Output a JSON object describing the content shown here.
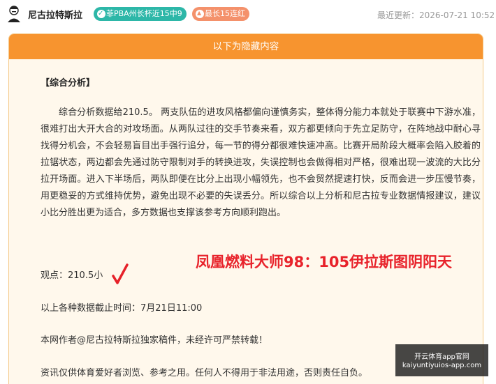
{
  "header": {
    "author": "尼古拉特斯拉",
    "badges": [
      {
        "label": "菲PBA州长杯近15中9",
        "color": "#2db7a8"
      },
      {
        "label": "最长15连红",
        "color": "#f4916b"
      }
    ],
    "updated": "最近更新：2026-07-21 10:52"
  },
  "card": {
    "header": "以下为隐藏内容",
    "section_title": "【综合分析】",
    "analysis": "综合分析数据给210.5。 两支队伍的进攻风格都偏向谨慎务实，整体得分能力本就处于联赛中下游水准，很难打出大开大合的对攻场面。从两队过往的交手节奏来看，双方都更倾向于先立足防守，在阵地战中耐心寻找得分机会，不会轻易盲目出手强行追分，每一节的得分都很难快速冲高。比赛开局阶段大概率会陷入胶着的拉锯状态，两边都会先通过防守限制对手的转换进攻，失误控制也会做得相对严格，很难出现一波流的大比分拉开场面。进入下半场后，两队即便在比分上出现小幅领先，也不会贸然提速打快，反而会进一步压慢节奏，用更稳妥的方式维持优势，避免出现不必要的失误丢分。所以综合以上分析和尼古拉专业数据情报建议，建议小比分胜出更为适合，多方数据也支撑该参考方向顺利跑出。",
    "viewpoint": "观点：210.5小",
    "watermark": "凤凰燃料大师98：105伊拉斯图阴阳天",
    "cutoff": "以上各种数据截止时间：7月21日11:00",
    "copyright": "本网作者@尼古拉特斯拉独家稿件，未经许可严禁转载！",
    "disclaimer": "资讯仅供体育爱好者浏览、参考之用。任何人不得用于非法用途，否则责任自负。"
  },
  "app_badge": {
    "line1": "开云体育app官网",
    "line2": "kaiyuntiyuios-app.com"
  },
  "colors": {
    "accent": "#f7942f",
    "card_bg": "#fff8ec",
    "red": "#e8232b"
  }
}
